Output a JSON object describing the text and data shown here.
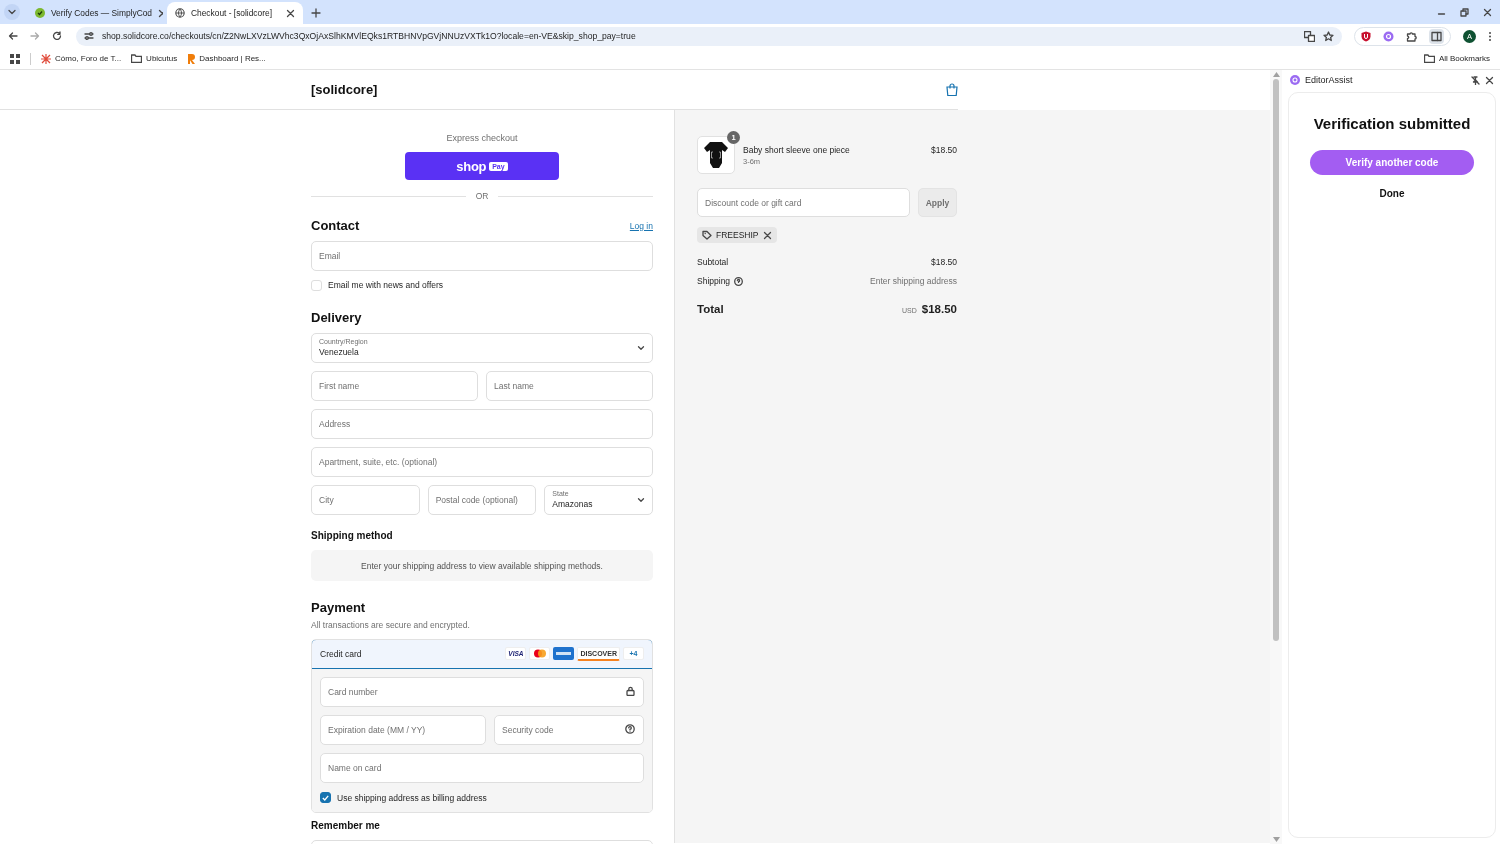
{
  "browser": {
    "tabs": [
      {
        "title": "Verify Codes — SimplyCod",
        "kind": "check",
        "selected": false
      },
      {
        "title": "Checkout - [solidcore]",
        "kind": "globe",
        "selected": true
      }
    ],
    "url": "shop.solidcore.co/checkouts/cn/Z2NwLXVzLWVhc3QxOjAxSlhKMVlEQks1RTBHNVpGVjNNUzVXTk1O?locale=en-VE&skip_shop_pay=true",
    "profile_initial": "A",
    "bookmarks": [
      {
        "label": "Cómo, Foro de T...",
        "kind": "site"
      },
      {
        "label": "Ubicutus",
        "kind": "folder"
      },
      {
        "label": "Dashboard | Res...",
        "kind": "brand"
      }
    ],
    "all_bookmarks": "All Bookmarks"
  },
  "header": {
    "logo": "[solidcore]"
  },
  "checkout": {
    "express_label": "Express checkout",
    "shop_pay": {
      "word": "shop",
      "badge": "Pay"
    },
    "divider": "OR",
    "contact": {
      "heading": "Contact",
      "login": "Log in",
      "email_placeholder": "Email",
      "newsletter": {
        "label": "Email me with news and offers",
        "checked": false
      }
    },
    "delivery": {
      "heading": "Delivery",
      "rows": [
        [
          {
            "kind": "select",
            "label": "Country/Region",
            "value": "Venezuela"
          }
        ],
        [
          {
            "kind": "input",
            "placeholder": "First name"
          },
          {
            "kind": "input",
            "placeholder": "Last name"
          }
        ],
        [
          {
            "kind": "input",
            "placeholder": "Address"
          }
        ],
        [
          {
            "kind": "input",
            "placeholder": "Apartment, suite, etc. (optional)"
          }
        ],
        [
          {
            "kind": "input",
            "placeholder": "City"
          },
          {
            "kind": "input",
            "placeholder": "Postal code (optional)"
          },
          {
            "kind": "select",
            "label": "State",
            "value": "Amazonas"
          }
        ]
      ]
    },
    "shipping_method": {
      "heading": "Shipping method",
      "notice": "Enter your shipping address to view available shipping methods."
    },
    "payment": {
      "heading": "Payment",
      "subtitle": "All transactions are secure and encrypted.",
      "method": {
        "label": "Credit card",
        "selected": true
      },
      "card_brands": [
        {
          "kind": "visa",
          "label": "VISA"
        },
        {
          "kind": "mastercard"
        },
        {
          "kind": "amex"
        },
        {
          "kind": "discover",
          "label": "DISCOVER"
        },
        {
          "kind": "more",
          "label": "+4"
        }
      ],
      "card_number_placeholder": "Card number",
      "expiry_placeholder": "Expiration date (MM / YY)",
      "security_placeholder": "Security code",
      "name_placeholder": "Name on card",
      "billing": {
        "label": "Use shipping address as billing address",
        "checked": true
      }
    },
    "remember_me": {
      "heading": "Remember me"
    }
  },
  "summary": {
    "item": {
      "name": "Baby short sleeve one piece",
      "variant": "3-6m",
      "price": "$18.50",
      "quantity": "1"
    },
    "discount_placeholder": "Discount code or gift card",
    "apply": "Apply",
    "code": "FREESHIP",
    "subtotal": {
      "label": "Subtotal",
      "value": "$18.50"
    },
    "shipping": {
      "label": "Shipping",
      "value": "Enter shipping address"
    },
    "total": {
      "label": "Total",
      "currency": "USD",
      "value": "$18.50"
    }
  },
  "panel": {
    "title": "EditorAssist",
    "heading": "Verification submitted",
    "primary": "Verify another code",
    "secondary": "Done"
  }
}
